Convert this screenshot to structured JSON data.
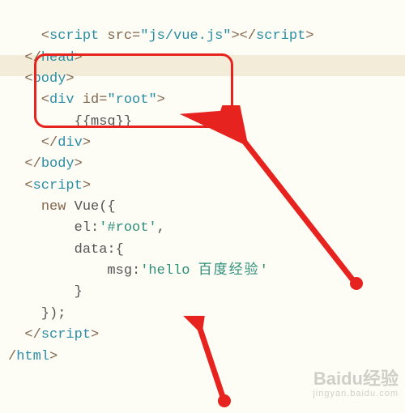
{
  "code": {
    "l1_a": "    <",
    "l1_b": "script",
    "l1_c": " src",
    "l1_d": "=",
    "l1_e": "\"js/vue.js\"",
    "l1_f": "></",
    "l1_g": "script",
    "l1_h": ">",
    "l2_a": "  </",
    "l2_b": "head",
    "l2_c": ">",
    "l3_a": "  <",
    "l3_b": "body",
    "l3_c": ">",
    "l4_a": "    <",
    "l4_b": "div",
    "l4_c": " id",
    "l4_d": "=",
    "l4_e": "\"root\"",
    "l4_f": ">",
    "l5": "        {{msg}}",
    "l6_a": "    </",
    "l6_b": "div",
    "l6_c": ">",
    "l7_a": "  </",
    "l7_b": "body",
    "l7_c": ">",
    "l8_a": "  <",
    "l8_b": "script",
    "l8_c": ">",
    "l9_a": "    ",
    "l9_b": "new",
    "l9_c": " Vue({",
    "l10": "        el:",
    "l10b": "'#root'",
    "l10c": ",",
    "l11": "        data:{",
    "l12": "            msg:",
    "l12b": "'hello ",
    "l12c": "百度经验",
    "l12d": "'",
    "l13": "        }",
    "l14": "    });",
    "l15_a": "  </",
    "l15_b": "script",
    "l15_c": ">",
    "l16_a": "/",
    "l16_b": "html",
    "l16_c": ">"
  },
  "watermark": {
    "brand": "Baidu经验",
    "sub": "jingyan.baidu.com"
  }
}
